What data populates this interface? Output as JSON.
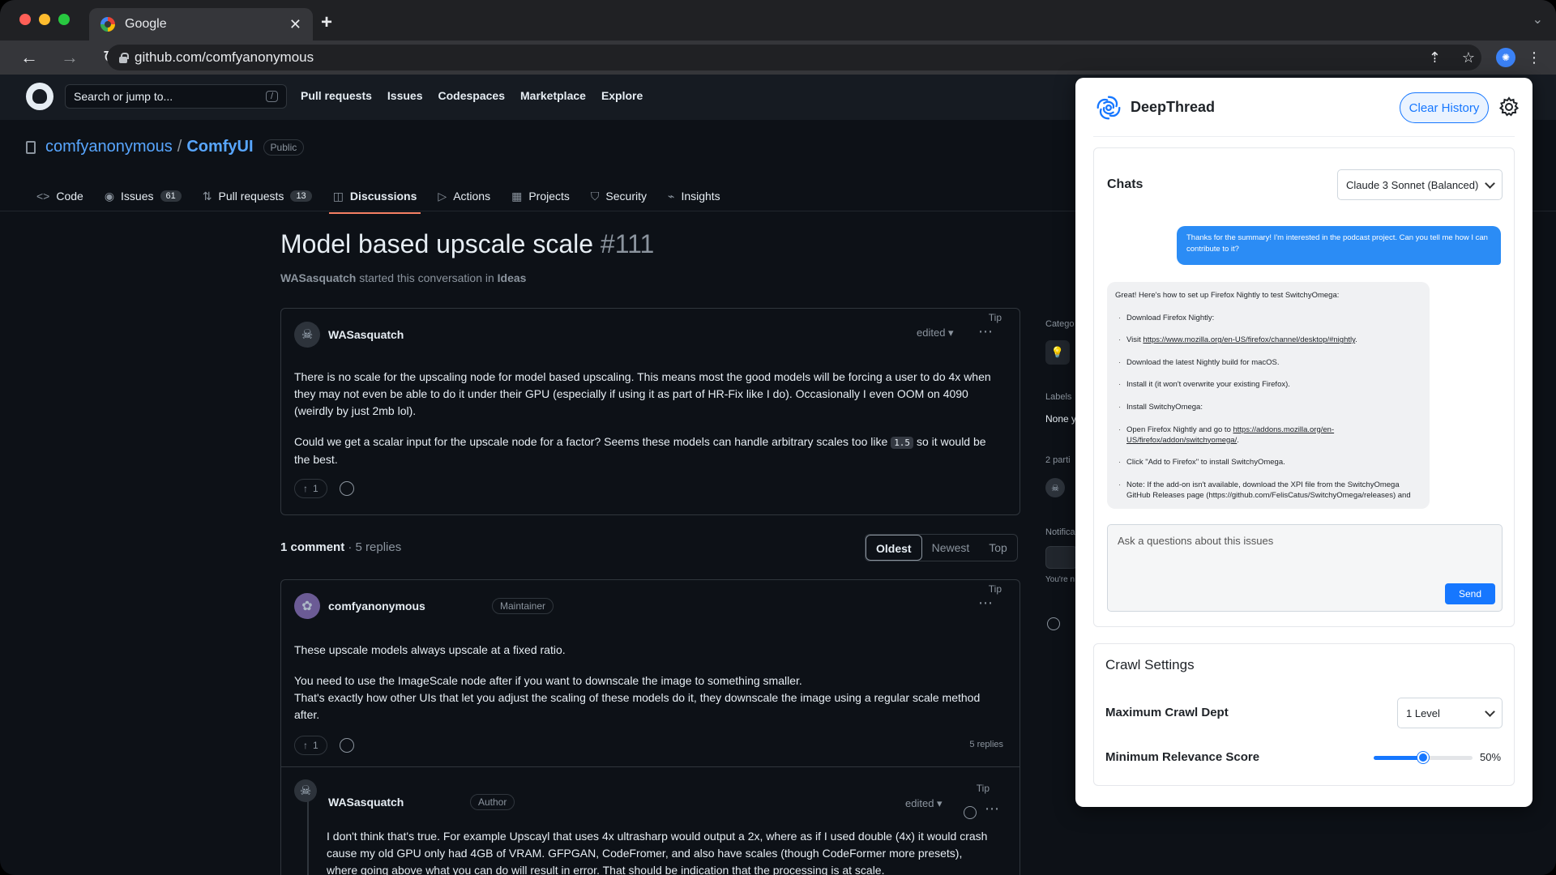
{
  "browser": {
    "tab_title": "Google",
    "url": "github.com/comfyanonymous"
  },
  "github": {
    "search_placeholder": "Search or jump to...",
    "search_shortcut": "/",
    "topnav": [
      "Pull requests",
      "Issues",
      "Codespaces",
      "Marketplace",
      "Explore"
    ],
    "repo_owner": "comfyanonymous",
    "repo_separator": "/",
    "repo_name": "ComfyUI",
    "repo_visibility": "Public",
    "tabs": [
      {
        "label": "Code",
        "icon": "<>",
        "count": ""
      },
      {
        "label": "Issues",
        "icon": "◉",
        "count": "61"
      },
      {
        "label": "Pull requests",
        "icon": "⇅",
        "count": "13"
      },
      {
        "label": "Discussions",
        "icon": "◫",
        "count": ""
      },
      {
        "label": "Actions",
        "icon": "▷",
        "count": ""
      },
      {
        "label": "Projects",
        "icon": "▦",
        "count": ""
      },
      {
        "label": "Security",
        "icon": "⛉",
        "count": ""
      },
      {
        "label": "Insights",
        "icon": "⌁",
        "count": ""
      }
    ],
    "discussion": {
      "title": "Model based upscale scale",
      "number": "#111",
      "starter": "WASasquatch",
      "started_text": "started this conversation in",
      "category": "Ideas"
    },
    "post": {
      "tip": "Tip",
      "author": "WASasquatch",
      "edited": "edited",
      "para1": "There is no scale for the upscaling node for model based upscaling. This means most the good models will be forcing a user to do 4x when they may not even be able to do it under their GPU (especially if using it as part of HR-Fix like I do). Occasionally I even OOM on 4090 (weirdly by just 2mb lol).",
      "para2_before": "Could we get a scalar input for the upscale node for a factor? Seems these models can handle arbitrary scales too like",
      "para2_code": "1.5",
      "para2_after": "so it would be the best.",
      "upvotes": "1"
    },
    "comments_summary": {
      "count": "1 comment",
      "replies": "· 5 replies",
      "sort": [
        "Oldest",
        "Newest",
        "Top"
      ]
    },
    "comment": {
      "tip": "Tip",
      "author": "comfyanonymous",
      "badge": "Maintainer",
      "p1": "These upscale models always upscale at a fixed ratio.",
      "p2": "You need to use the ImageScale node after if you want to downscale the image to something smaller.",
      "p3": "That's exactly how other UIs that let you adjust the scaling of these models do it, they downscale the image using a regular scale method after.",
      "upvotes": "1",
      "replies": "5 replies"
    },
    "reply": {
      "tip": "Tip",
      "author": "WASasquatch",
      "badge": "Author",
      "edited": "edited",
      "text": "I don't think that's true. For example Upscayl that uses 4x ultrasharp would output a 2x, where as if I used double (4x) it would crash cause my old GPU only had 4GB of VRAM. GFPGAN, CodeFromer, and also have scales (though CodeFormer more presets), where going above what you can do will result in error. That should be indication that the processing is at scale."
    },
    "sidebar_fragments": {
      "category": "Catego",
      "labels": "Labels",
      "labels_value": "None y",
      "participants": "2 parti",
      "notifications": "Notifica",
      "notif_note": "You're n"
    }
  },
  "deepthread": {
    "title": "DeepThread",
    "clear_history": "Clear History",
    "chats_label": "Chats",
    "model": "Claude 3 Sonnet (Balanced)",
    "user_message": "Thanks for the summary! I'm interested in the podcast project. Can you tell me how I can contribute to it?",
    "bot_intro": "Great! Here's how to set up Firefox Nightly to test SwitchyOmega:",
    "bot_items": [
      {
        "text": "Download Firefox Nightly:",
        "link": ""
      },
      {
        "text": "Visit ",
        "link": "https://www.mozilla.org/en-US/firefox/channel/desktop/#nightly",
        "after": "."
      },
      {
        "text": "Download the latest Nightly build for macOS.",
        "link": ""
      },
      {
        "text": "Install it (it won't overwrite your existing Firefox).",
        "link": ""
      },
      {
        "text": "Install SwitchyOmega:",
        "link": ""
      },
      {
        "text": "Open Firefox Nightly and go to ",
        "link": "https://addons.mozilla.org/en-US/firefox/addon/switchyomega/",
        "after": "."
      },
      {
        "text": "Click \"Add to Firefox\" to install SwitchyOmega.",
        "link": ""
      },
      {
        "text": "Note: If the add-on isn't available, download the XPI file from the SwitchyOmega GitHub Releases page (https://github.com/FelisCatus/SwitchyOmega/releases) and",
        "link": ""
      }
    ],
    "ask_placeholder": "Ask a questions about this issues",
    "send_label": "Send",
    "crawl_title": "Crawl Settings",
    "depth_label": "Maximum Crawl Dept",
    "depth_value": "1 Level",
    "relevance_label": "Minimum Relevance Score",
    "relevance_value": 50,
    "relevance_display": "50%",
    "accent_color": "#1677ff"
  }
}
